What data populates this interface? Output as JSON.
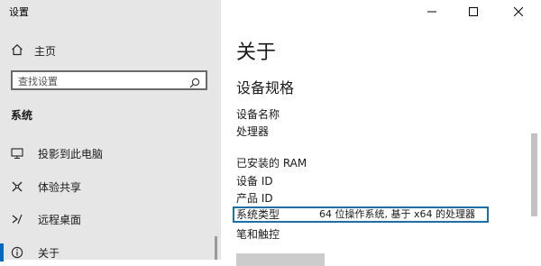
{
  "window": {
    "title": "设置"
  },
  "nav": {
    "home_label": "主页",
    "search_placeholder": "查找设置",
    "section_title": "系统",
    "items": [
      {
        "label": "投影到此电脑",
        "icon": "monitor-icon"
      },
      {
        "label": "体验共享",
        "icon": "share-icon"
      },
      {
        "label": "远程桌面",
        "icon": "remote-desktop-icon"
      },
      {
        "label": "关于",
        "icon": "info-icon",
        "active": true
      }
    ]
  },
  "content": {
    "title": "关于",
    "spec_heading": "设备规格",
    "rows": [
      "设备名称",
      "处理器",
      "已安装的 RAM",
      "设备 ID",
      "产品 ID"
    ],
    "highlight": {
      "label": "系统类型",
      "value": "64 位操作系统, 基于 x64 的处理器"
    },
    "pen_label": "笔和触控"
  },
  "colors": {
    "accent": "#0067c0",
    "highlight_border": "#1c6fa8",
    "nav_bg": "#e6e6e6"
  }
}
